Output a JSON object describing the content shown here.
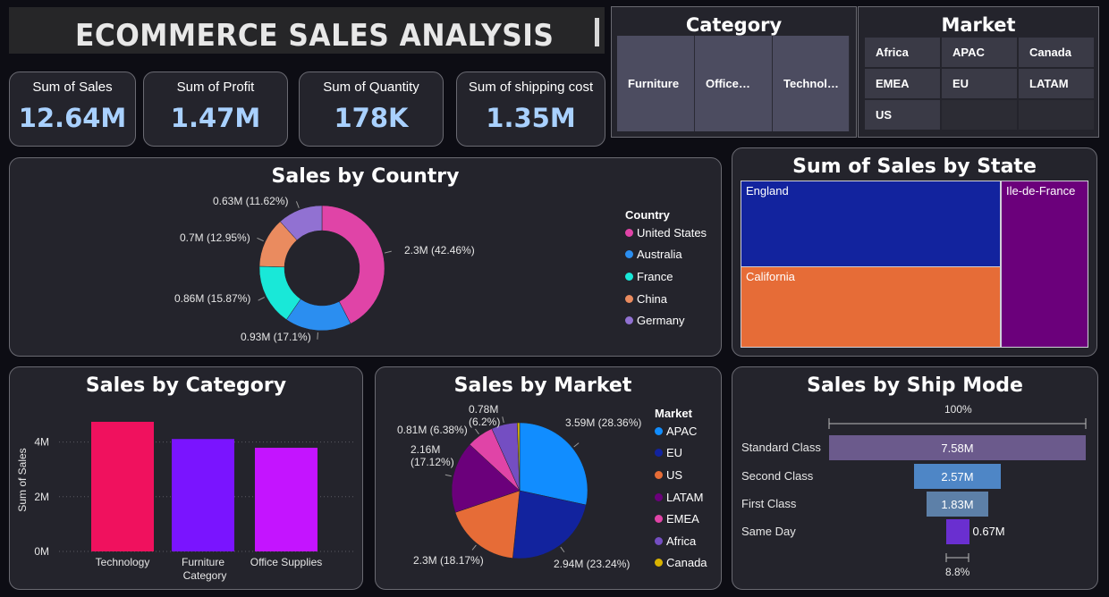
{
  "header": {
    "title": "ECOMMERCE SALES ANALYSIS"
  },
  "kpis": [
    {
      "label": "Sum of Sales",
      "value": "12.64M"
    },
    {
      "label": "Sum of Profit",
      "value": "1.47M"
    },
    {
      "label": "Sum of Quantity",
      "value": "178K"
    },
    {
      "label": "Sum of shipping cost",
      "value": "1.35M"
    }
  ],
  "category_slicer": {
    "title": "Category",
    "items": [
      "Furniture",
      "Office…",
      "Technol…"
    ]
  },
  "market_slicer": {
    "title": "Market",
    "items": [
      "Africa",
      "APAC",
      "Canada",
      "EMEA",
      "EU",
      "LATAM",
      "US"
    ]
  },
  "sales_by_country": {
    "title": "Sales by Country",
    "legend_title": "Country",
    "chart_data": {
      "type": "pie",
      "categories": [
        "United States",
        "Australia",
        "France",
        "China",
        "Germany"
      ],
      "values": [
        2.3,
        0.93,
        0.86,
        0.7,
        0.63
      ],
      "labels": [
        "2.3M (42.46%)",
        "0.93M (17.1%)",
        "0.86M (15.87%)",
        "0.7M (12.95%)",
        "0.63M (11.62%)"
      ],
      "colors": [
        "#e044a7",
        "#2b8ef0",
        "#19e8d8",
        "#ea8b5f",
        "#9171d2"
      ]
    }
  },
  "sales_by_state": {
    "title": "Sum of Sales by State",
    "chart_data": {
      "type": "treemap",
      "categories": [
        "England",
        "California",
        "Ile-de-France"
      ],
      "colors": [
        "#12239e",
        "#e66c37",
        "#6b007b"
      ]
    }
  },
  "sales_by_category": {
    "title": "Sales by Category",
    "chart_data": {
      "type": "bar",
      "categories": [
        "Technology",
        "Furniture",
        "Office Supplies"
      ],
      "values": [
        4.74,
        4.11,
        3.79
      ],
      "colors": [
        "#f0115e",
        "#7a14ff",
        "#c414ff"
      ],
      "xlabel": "Category",
      "ylabel": "Sum of Sales",
      "yticks": [
        "0M",
        "2M",
        "4M"
      ],
      "ylim": [
        0,
        5
      ]
    }
  },
  "sales_by_market": {
    "title": "Sales by Market",
    "legend_title": "Market",
    "chart_data": {
      "type": "pie",
      "categories": [
        "APAC",
        "EU",
        "US",
        "LATAM",
        "EMEA",
        "Africa",
        "Canada"
      ],
      "values": [
        3.59,
        2.94,
        2.3,
        2.16,
        0.81,
        0.78,
        0.07
      ],
      "labels": [
        "3.59M (28.36%)",
        "2.94M (23.24%)",
        "2.3M (18.17%)",
        "2.16M\n(17.12%)",
        "0.81M (6.38%)",
        "0.78M\n(6.2%)",
        ""
      ],
      "colors": [
        "#118dff",
        "#12239e",
        "#e66c37",
        "#6b007b",
        "#e044a7",
        "#744ec2",
        "#d9b300"
      ]
    }
  },
  "sales_by_ship_mode": {
    "title": "Sales by Ship Mode",
    "top_pct": "100%",
    "bottom_pct": "8.8%",
    "chart_data": {
      "type": "funnel",
      "categories": [
        "Standard Class",
        "Second Class",
        "First Class",
        "Same Day"
      ],
      "values": [
        7.58,
        2.57,
        1.83,
        0.67
      ],
      "labels": [
        "7.58M",
        "2.57M",
        "1.83M",
        "0.67M"
      ],
      "colors": [
        "#6b5a8c",
        "#4e86c6",
        "#5d80a8",
        "#6a2fd0"
      ]
    }
  }
}
